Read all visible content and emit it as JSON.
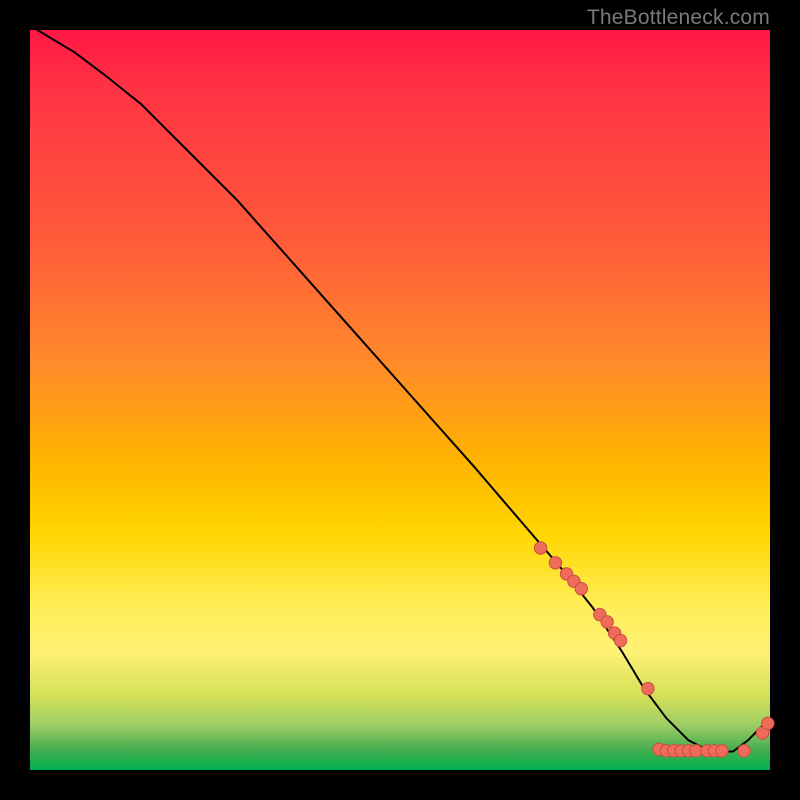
{
  "watermark": "TheBottleneck.com",
  "colors": {
    "curve_stroke": "#000000",
    "dot_fill": "#ef6b5a",
    "dot_stroke": "#c94f40"
  },
  "chart_data": {
    "type": "line",
    "title": "",
    "xlabel": "",
    "ylabel": "",
    "ylim": [
      0,
      100
    ],
    "xlim": [
      0,
      100
    ],
    "note": "Axes are unlabeled in the source image; x/y are treated as 0–100% of the plot area. y=100 at top, y=0 at bottom.",
    "series": [
      {
        "name": "curve",
        "kind": "line",
        "x": [
          1,
          6,
          10,
          15,
          20,
          28,
          36,
          44,
          52,
          60,
          66,
          72,
          76,
          80,
          83,
          86,
          89,
          92,
          95,
          97,
          99
        ],
        "y": [
          100,
          97,
          94,
          90,
          85,
          77,
          68,
          59,
          50,
          41,
          34,
          27,
          22,
          16,
          11,
          7,
          4,
          2.5,
          2.5,
          4,
          6
        ]
      },
      {
        "name": "points-descending",
        "kind": "scatter",
        "x": [
          69,
          71,
          72.5,
          73.5,
          74.5,
          77,
          78,
          79,
          79.8,
          83.5
        ],
        "y": [
          30,
          28,
          26.5,
          25.5,
          24.5,
          21,
          20,
          18.5,
          17.5,
          11
        ]
      },
      {
        "name": "points-floor",
        "kind": "scatter",
        "x": [
          85,
          86,
          87,
          88,
          89,
          90,
          91.5,
          92.5,
          93.5,
          96.5
        ],
        "y": [
          2.8,
          2.6,
          2.6,
          2.6,
          2.6,
          2.6,
          2.6,
          2.6,
          2.6,
          2.6
        ]
      },
      {
        "name": "points-tail-up",
        "kind": "scatter",
        "x": [
          99,
          99.7
        ],
        "y": [
          5,
          6.3
        ]
      }
    ]
  }
}
